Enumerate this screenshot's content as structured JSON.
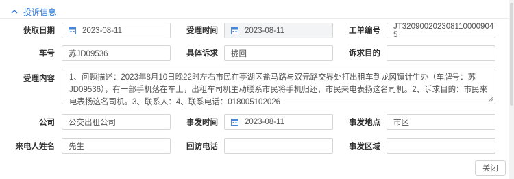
{
  "section": {
    "title": "投诉信息",
    "icon": "chevron-up-icon",
    "color": "#2f7ad8"
  },
  "fields": {
    "get_date": {
      "label": "获取日期",
      "value": "2023-08-11",
      "icon": "calendar-icon"
    },
    "accept_time": {
      "label": "受理时间",
      "value": "2023-08-11",
      "icon": "calendar-icon"
    },
    "ticket_no": {
      "label": "工单编号",
      "value": "JT320900202308110000904​5"
    },
    "plate": {
      "label": "车号",
      "value": "苏JD09536"
    },
    "specific_complaint": {
      "label": "具体诉求",
      "value": "拢回"
    },
    "complaint_purpose": {
      "label": "诉求目的",
      "value": ""
    },
    "accept_content": {
      "label": "受理内容",
      "value": "1、问题描述：2023年8月10日晚22时左右市民在亭湖区盐马路与双元路交界处打出租车到龙冈镇计生办（车牌号：苏JD09536），有一部手机落在车上，出租车司机主动联系市民将手机归还，市民来电表扬这名司机。2、诉求目的：市民来电表扬这名司机。3、联系人：4、联系电话：018005102026"
    },
    "company": {
      "label": "公司",
      "value": "公交出租公司"
    },
    "incident_time": {
      "label": "事发时间",
      "value": "2023-08-11",
      "icon": "calendar-icon"
    },
    "incident_place": {
      "label": "事发地点",
      "value": "市区"
    },
    "caller_name": {
      "label": "来电人姓名",
      "value": "先生"
    },
    "callback_phone": {
      "label": "回访电话",
      "value": ""
    },
    "incident_area": {
      "label": "事发区域",
      "value": ""
    }
  },
  "buttons": {
    "close": "关闭"
  }
}
